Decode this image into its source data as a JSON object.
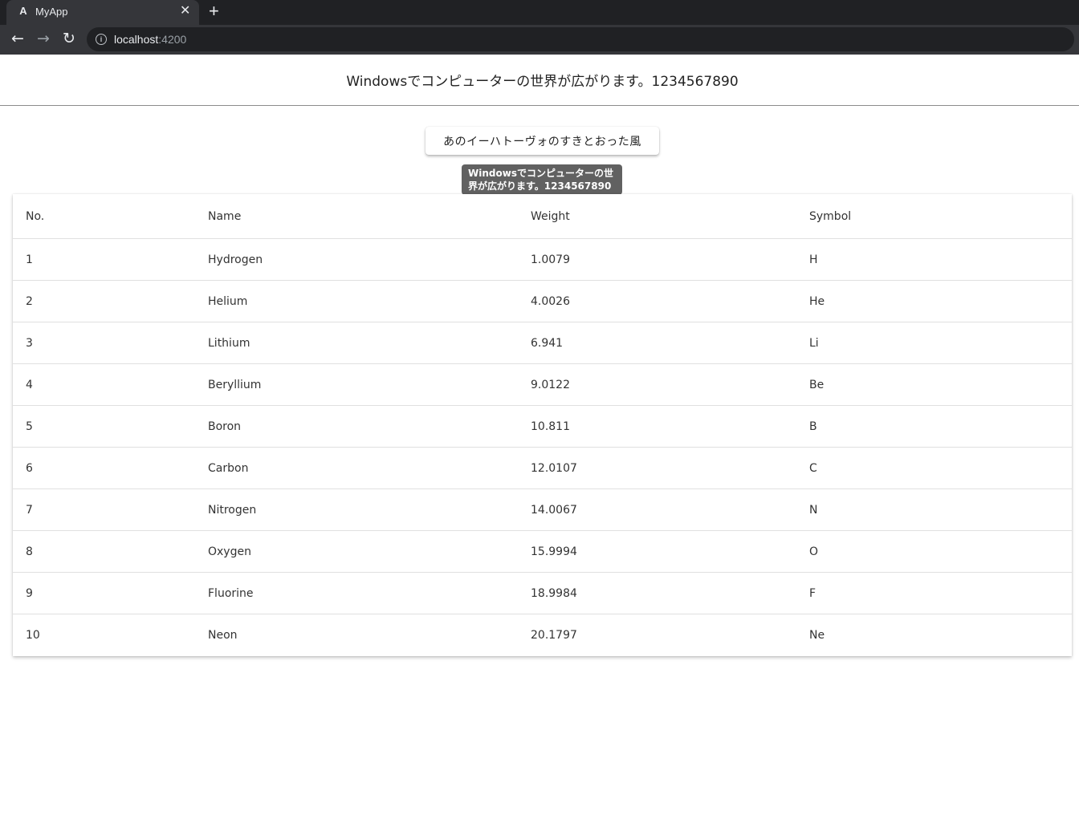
{
  "browser": {
    "tab_title": "MyApp",
    "tab_icon": "A",
    "url_host": "localhost",
    "url_port": ":4200"
  },
  "page": {
    "title": "Windowsでコンピューターの世界が広がります。1234567890",
    "button_label": "あのイーハトーヴォのすきとおった風",
    "tooltip_line1": "Windowsでコンピューターの世",
    "tooltip_line2": "界が広がります。1234567890"
  },
  "table": {
    "headers": [
      "No.",
      "Name",
      "Weight",
      "Symbol"
    ],
    "rows": [
      [
        "1",
        "Hydrogen",
        "1.0079",
        "H"
      ],
      [
        "2",
        "Helium",
        "4.0026",
        "He"
      ],
      [
        "3",
        "Lithium",
        "6.941",
        "Li"
      ],
      [
        "4",
        "Beryllium",
        "9.0122",
        "Be"
      ],
      [
        "5",
        "Boron",
        "10.811",
        "B"
      ],
      [
        "6",
        "Carbon",
        "12.0107",
        "C"
      ],
      [
        "7",
        "Nitrogen",
        "14.0067",
        "N"
      ],
      [
        "8",
        "Oxygen",
        "15.9994",
        "O"
      ],
      [
        "9",
        "Fluorine",
        "18.9984",
        "F"
      ],
      [
        "10",
        "Neon",
        "20.1797",
        "Ne"
      ]
    ]
  }
}
